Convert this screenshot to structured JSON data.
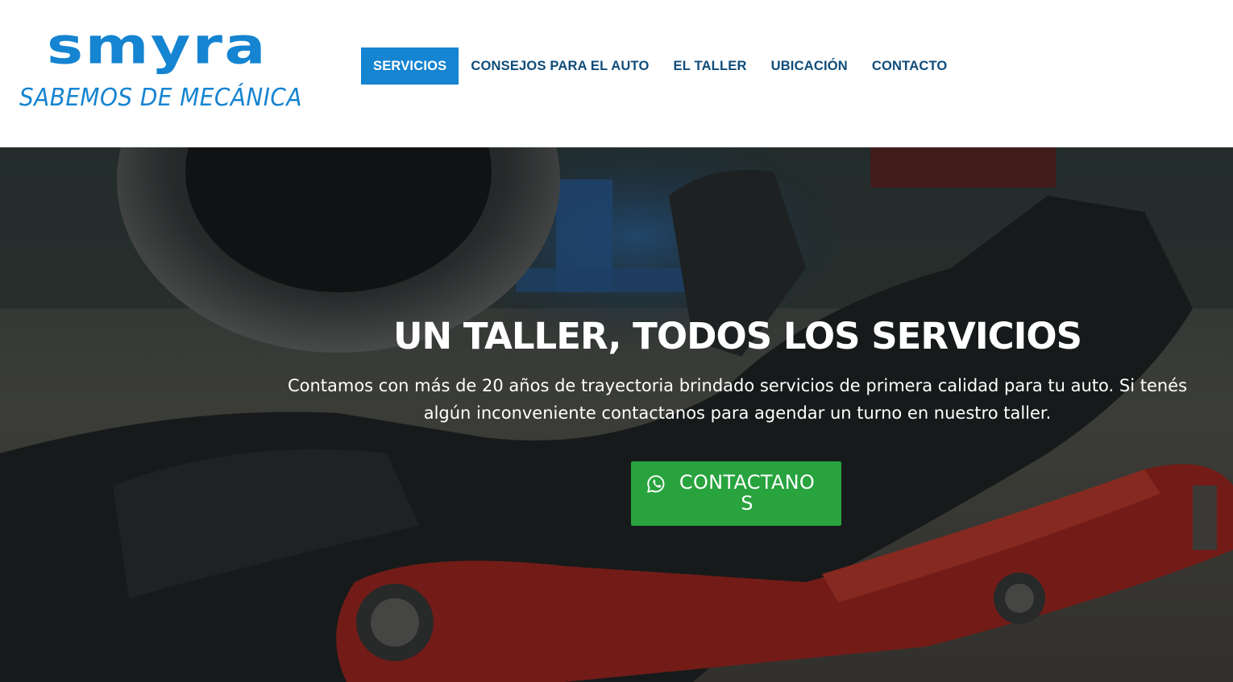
{
  "brand": {
    "name": "SMYRA",
    "tagline": "SABEMOS DE MECÁNICA",
    "color": "#1584d1"
  },
  "nav": {
    "items": [
      {
        "label": "SERVICIOS",
        "active": true
      },
      {
        "label": "CONSEJOS PARA EL AUTO",
        "active": false
      },
      {
        "label": "EL TALLER",
        "active": false
      },
      {
        "label": "UBICACIÓN",
        "active": false
      },
      {
        "label": "CONTACTO",
        "active": false
      }
    ],
    "text_color": "#0f4c7a",
    "active_bg": "#1584d1"
  },
  "hero": {
    "title": "UN TALLER, TODOS LOS SERVICIOS",
    "description": "Contamos con más de 20 años de trayectoria brindado servicios de primera calidad para tu auto. Si tenés algún inconveniente contactanos para agendar un turno en nuestro taller.",
    "cta": {
      "label": "CONTACTANOS",
      "icon": "whatsapp-icon",
      "color": "#28a33e"
    },
    "background_image": "mechanic-lying-on-creeper-under-car"
  }
}
